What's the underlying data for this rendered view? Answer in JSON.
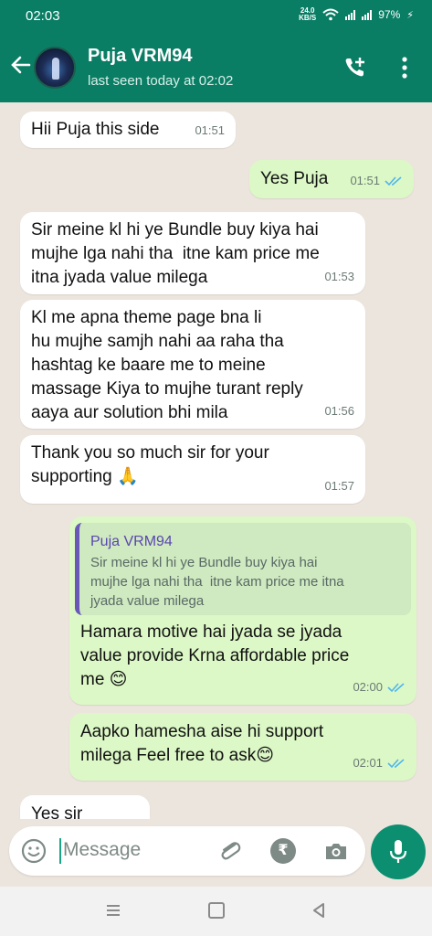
{
  "status": {
    "time": "02:03",
    "speed_top": "24.0",
    "speed_unit": "KB/S",
    "battery": "97%"
  },
  "header": {
    "name": "Puja VRM94",
    "last_seen": "last seen today at 02:02"
  },
  "messages": [
    {
      "dir": "in",
      "text": "Hii Puja this side",
      "time": "01:51"
    },
    {
      "dir": "out",
      "text": "Yes Puja",
      "time": "01:51",
      "read": true
    },
    {
      "dir": "in",
      "text": "Sir meine kl hi ye Bundle buy kiya hai\nmujhe lga nahi tha  itne kam price me\nitna jyada value milega",
      "time": "01:53"
    },
    {
      "dir": "in",
      "text": "Kl me apna theme page bna li\nhu mujhe samjh nahi aa raha tha\nhashtag ke baare me to meine\nmassage Kiya to mujhe turant reply\naaya aur solution bhi mila",
      "time": "01:56"
    },
    {
      "dir": "in",
      "text": "Thank you so much sir for your\nsupporting 🙏",
      "time": "01:57"
    },
    {
      "dir": "out",
      "quote_name": "Puja VRM94",
      "quote_text": "Sir meine kl hi ye Bundle buy kiya hai\nmujhe lga nahi tha  itne kam price me itna\njyada value milega",
      "text": "Hamara motive hai jyada se jyada\nvalue provide Krna affordable price\nme 😊",
      "time": "02:00",
      "read": true
    },
    {
      "dir": "out",
      "text": "Aapko hamesha aise hi support\nmilega Feel free to ask😊",
      "time": "02:01",
      "read": true
    },
    {
      "dir": "in",
      "text": "Yes sir",
      "time": "",
      "partial": true
    }
  ],
  "input": {
    "placeholder": "Message"
  },
  "icons": {
    "back": "back-arrow-icon",
    "call": "add-call-icon",
    "menu": "more-vert-icon",
    "emoji": "emoji-icon",
    "attach": "paperclip-icon",
    "payment": "rupee-icon",
    "camera": "camera-icon",
    "mic": "mic-icon"
  },
  "colors": {
    "header": "#0a7e65",
    "outgoing": "#dcf8c6",
    "incoming": "#ffffff",
    "tick": "#4fb6ec",
    "mic": "#0b8f70"
  }
}
